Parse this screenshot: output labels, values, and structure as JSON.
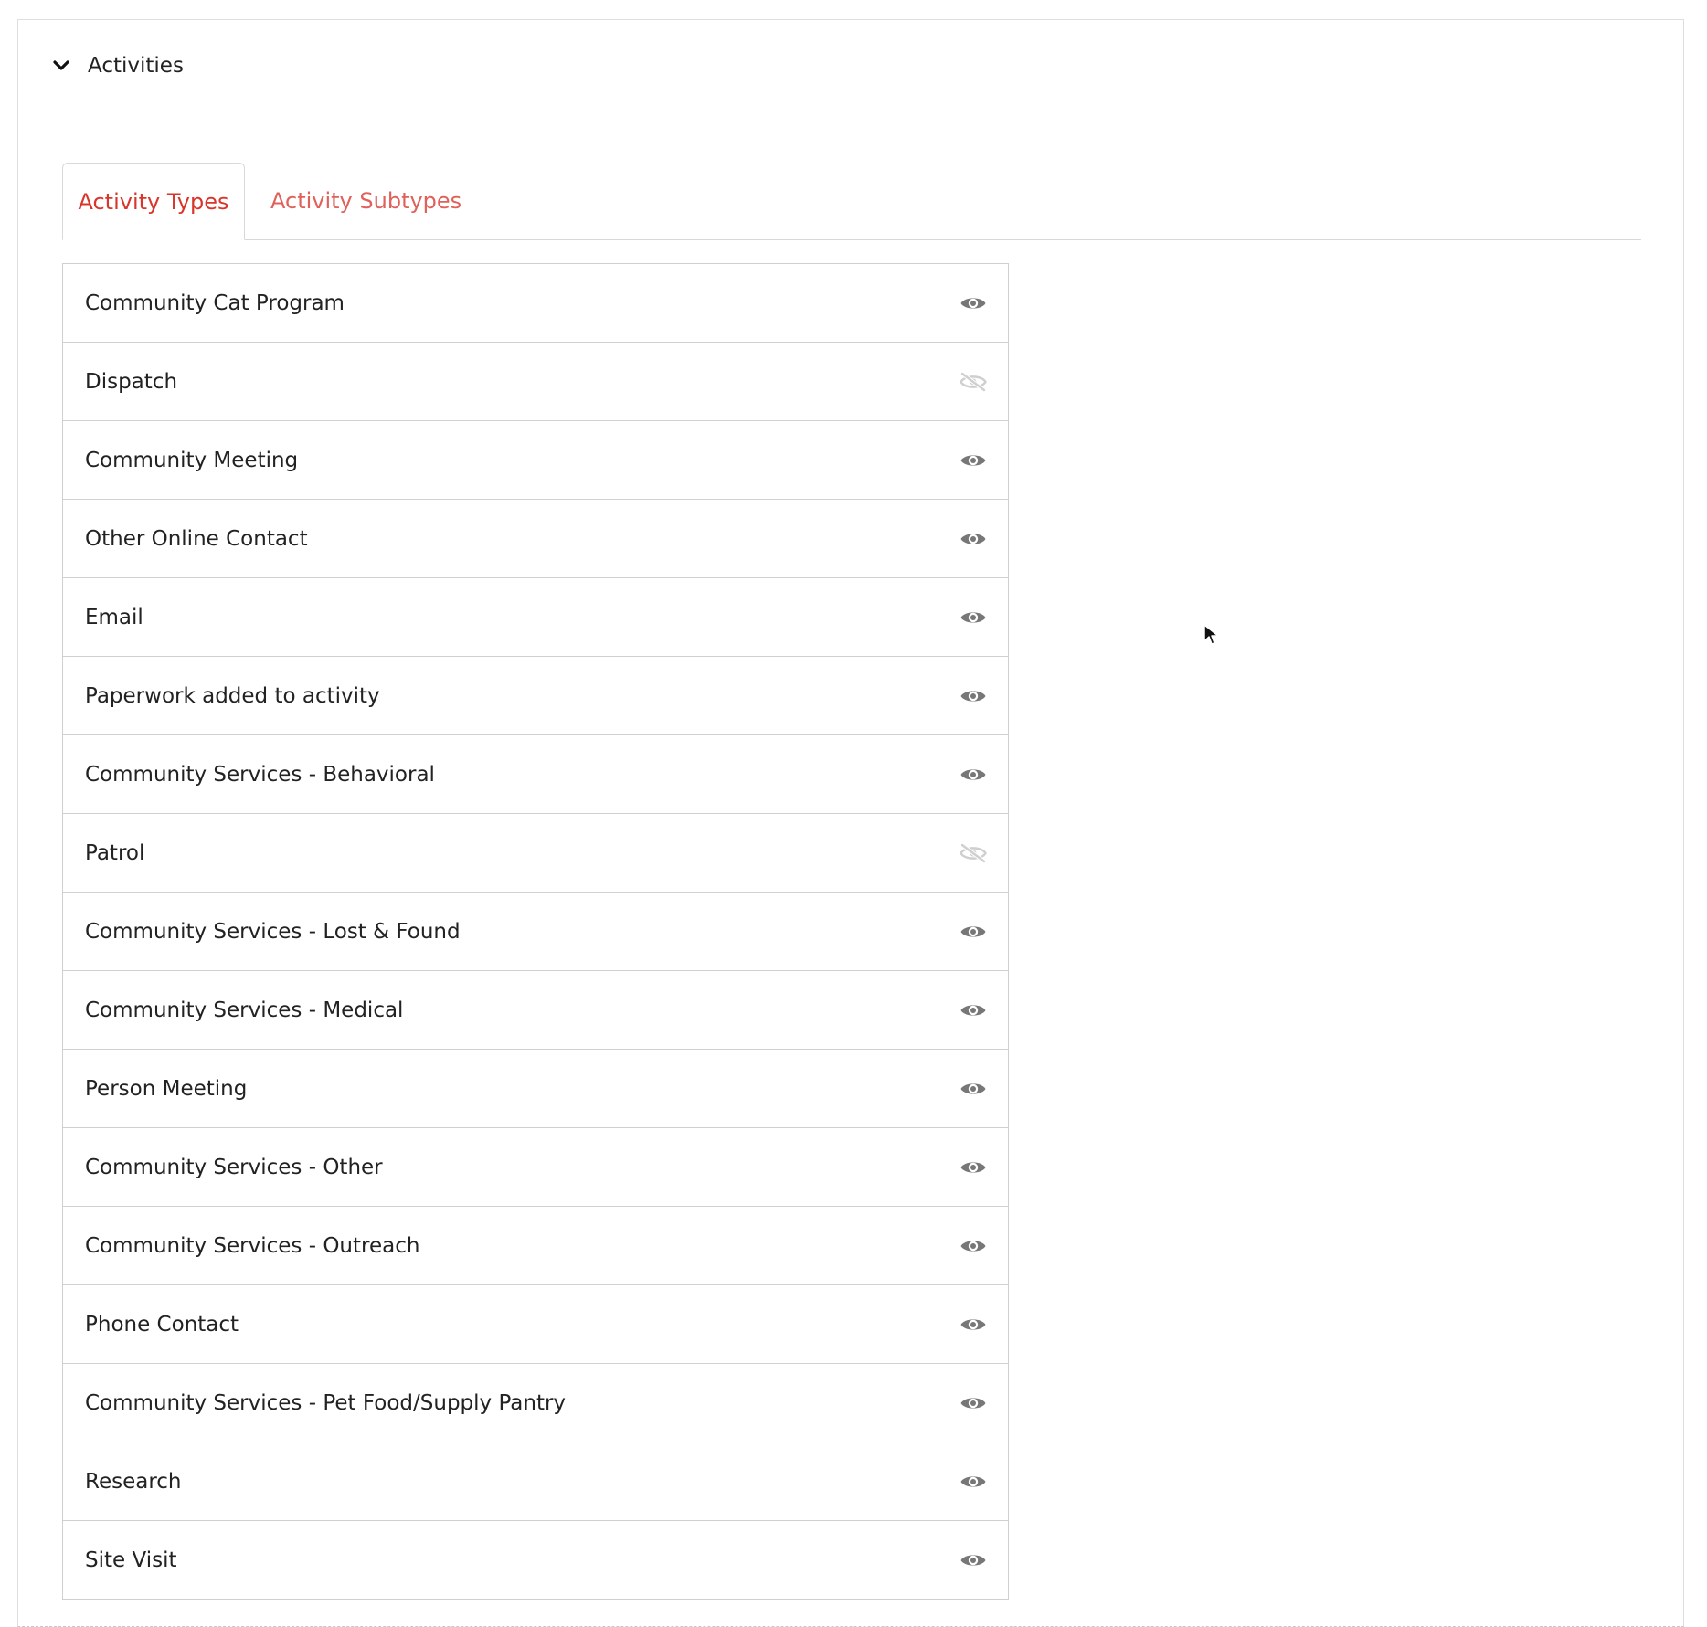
{
  "panel": {
    "title": "Activities",
    "expanded_icon": "chevron-down-icon"
  },
  "tabs": [
    {
      "label": "Activity Types",
      "active": true
    },
    {
      "label": "Activity Subtypes",
      "active": false
    }
  ],
  "colors": {
    "accent": "#d9362b",
    "accent_light": "#e0615a",
    "eye_visible": "#777777",
    "eye_hidden": "#cfcfcf"
  },
  "activity_types": [
    {
      "label": "Community Cat Program",
      "visible": true
    },
    {
      "label": "Dispatch",
      "visible": false
    },
    {
      "label": "Community Meeting",
      "visible": true
    },
    {
      "label": "Other Online Contact",
      "visible": true
    },
    {
      "label": "Email",
      "visible": true
    },
    {
      "label": "Paperwork added to activity",
      "visible": true
    },
    {
      "label": "Community Services - Behavioral",
      "visible": true
    },
    {
      "label": "Patrol",
      "visible": false
    },
    {
      "label": "Community Services - Lost & Found",
      "visible": true
    },
    {
      "label": "Community Services - Medical",
      "visible": true
    },
    {
      "label": "Person Meeting",
      "visible": true
    },
    {
      "label": "Community Services - Other",
      "visible": true
    },
    {
      "label": "Community Services - Outreach",
      "visible": true
    },
    {
      "label": "Phone Contact",
      "visible": true
    },
    {
      "label": "Community Services - Pet Food/Supply Pantry",
      "visible": true
    },
    {
      "label": "Research",
      "visible": true
    },
    {
      "label": "Site Visit",
      "visible": true
    }
  ]
}
